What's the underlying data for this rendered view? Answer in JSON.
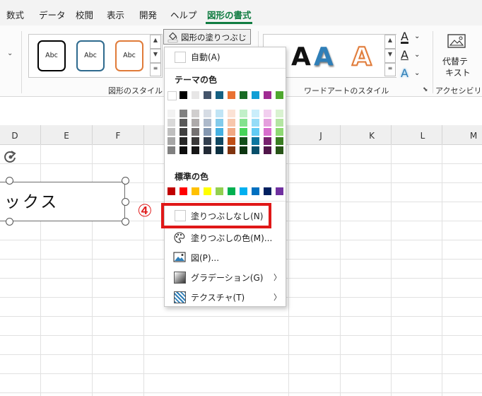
{
  "ribbon": {
    "tabs": [
      {
        "label": "数式"
      },
      {
        "label": "データ"
      },
      {
        "label": "校閲"
      },
      {
        "label": "表示"
      },
      {
        "label": "開発"
      },
      {
        "label": "ヘルプ"
      },
      {
        "label": "図形の書式",
        "active": true
      }
    ],
    "shape_styles": {
      "thumbs": [
        {
          "label": "Abc",
          "border": "#000000"
        },
        {
          "label": "Abc",
          "border": "#2e6a8e"
        },
        {
          "label": "Abc",
          "border": "#e07b39"
        }
      ],
      "group_label": "図形のスタイル"
    },
    "fill_button": {
      "label": "図形の塗りつぶし",
      "icon": "paint-bucket-icon"
    },
    "wordart": {
      "letters": [
        "A",
        "A",
        "A"
      ],
      "group_label": "ワードアートのスタイル",
      "text_fill_icon": "A",
      "text_outline_icon": "A",
      "text_effects_icon": "A"
    },
    "alt_text": {
      "line1": "代替テ",
      "line2": "キスト",
      "group_label": "アクセシビリ..."
    }
  },
  "grid": {
    "columns": [
      "D",
      "E",
      "F",
      "J",
      "K",
      "L",
      "M"
    ]
  },
  "shape": {
    "text": "ックス"
  },
  "fill_menu": {
    "auto_label": "自動(A)",
    "theme_colors_heading": "テーマの色",
    "theme_top_row": [
      "#ffffff",
      "#000000",
      "#e7e6e6",
      "#44546a",
      "#156082",
      "#e97132",
      "#196b24",
      "#0f9ed5",
      "#a02b93",
      "#4ea72e"
    ],
    "theme_shades": [
      [
        "#f2f2f2",
        "#808080",
        "#d0cece",
        "#d6dce4",
        "#c0e4f5",
        "#fbe2d5",
        "#c1f0c8",
        "#caeefb",
        "#f2ceef",
        "#d9f2d0"
      ],
      [
        "#d9d9d9",
        "#595959",
        "#aeaaaa",
        "#adb9ca",
        "#83cbeb",
        "#f7c7ac",
        "#83e28e",
        "#95dcf7",
        "#e59edd",
        "#b4e5a2"
      ],
      [
        "#bfbfbf",
        "#404040",
        "#757171",
        "#8497b0",
        "#45b0e1",
        "#f1a983",
        "#47d459",
        "#61cbf4",
        "#d86dcd",
        "#8ed973"
      ],
      [
        "#a6a6a6",
        "#262626",
        "#3a3838",
        "#333f4f",
        "#0f4761",
        "#c04f15",
        "#124f1a",
        "#0b76a0",
        "#78206e",
        "#3a7d22"
      ],
      [
        "#808080",
        "#0d0d0d",
        "#171616",
        "#222a35",
        "#0a2f40",
        "#80340e",
        "#0c3511",
        "#074f6a",
        "#501549",
        "#275317"
      ]
    ],
    "standard_colors_heading": "標準の色",
    "standard_colors": [
      "#c00000",
      "#ff0000",
      "#ffc000",
      "#ffff00",
      "#92d050",
      "#00b050",
      "#00b0f0",
      "#0070c0",
      "#002060",
      "#7030a0"
    ],
    "no_fill_label": "塗りつぶしなし(N)",
    "more_colors_label": "塗りつぶしの色(M)...",
    "picture_label": "図(P)...",
    "gradient_label": "グラデーション(G)",
    "texture_label": "テクスチャ(T)"
  },
  "annotation": {
    "step_marker": "④",
    "highlight_color": "#e01818"
  }
}
